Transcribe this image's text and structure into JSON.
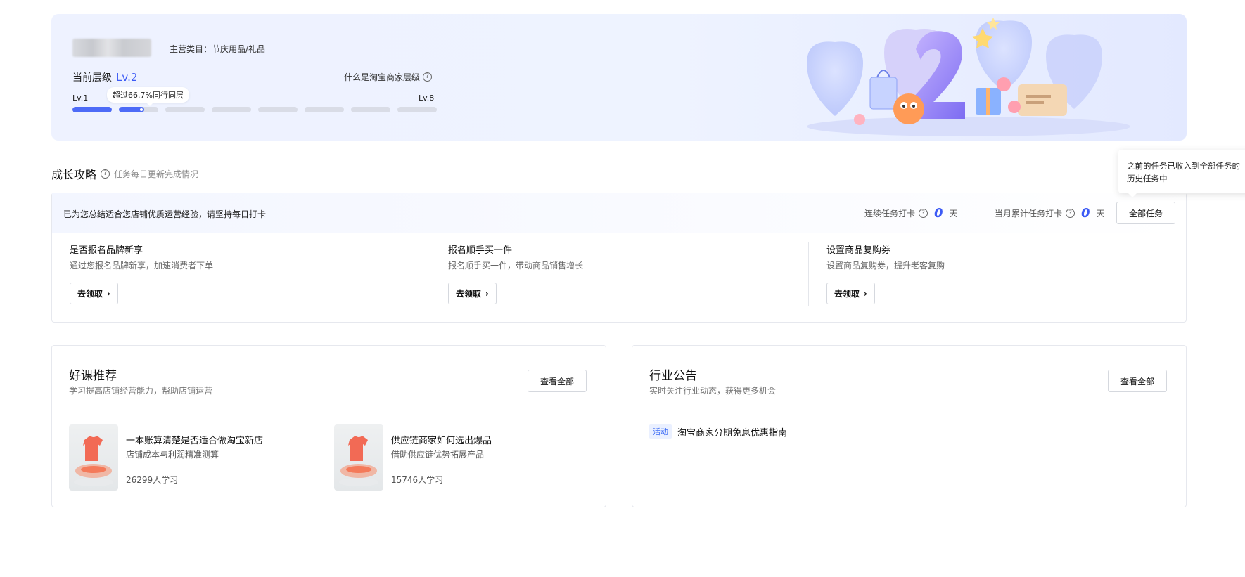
{
  "banner": {
    "category_label": "主营类目：",
    "category_value": "节庆用品/礼品",
    "current_level_label": "当前层级",
    "current_level_value": "Lv.2",
    "what_is_level": "什么是淘宝商家层级",
    "level_start": "Lv.1",
    "level_end": "Lv.8",
    "peer_tooltip": "超过66.7%同行同层",
    "progress": {
      "segments": 8,
      "current_index": 2,
      "current_fill_fraction": 0.65
    }
  },
  "growth": {
    "title": "成长攻略",
    "subtitle": "任务每日更新完成情况",
    "intro": "已为您总结适合您店铺优质运营经验，请坚持每日打卡",
    "streak_label": "连续任务打卡",
    "streak_value": "0",
    "streak_unit": "天",
    "month_label": "当月累计任务打卡",
    "month_value": "0",
    "month_unit": "天",
    "all_tasks_button": "全部任务",
    "tip_text": "之前的任务已收入到全部任务的历史任务中",
    "tasks": [
      {
        "name": "是否报名品牌新享",
        "desc": "通过您报名品牌新享，加速消费者下单",
        "button": "去领取"
      },
      {
        "name": "报名顺手买一件",
        "desc": "报名顺手买一件，带动商品销售增长",
        "button": "去领取"
      },
      {
        "name": "设置商品复购券",
        "desc": "设置商品复购券，提升老客复购",
        "button": "去领取"
      }
    ]
  },
  "courses": {
    "title": "好课推荐",
    "subtitle": "学习提高店铺经营能力，帮助店铺运营",
    "view_all": "查看全部",
    "items": [
      {
        "title": "一本账算清楚是否适合做淘宝新店",
        "subtitle": "店铺成本与利润精准测算",
        "learners": "26299人学习"
      },
      {
        "title": "供应链商家如何选出爆品",
        "subtitle": "借助供应链优势拓展产品",
        "learners": "15746人学习"
      }
    ]
  },
  "notices": {
    "title": "行业公告",
    "subtitle": "实时关注行业动态，获得更多机会",
    "view_all": "查看全部",
    "items": [
      {
        "tag": "活动",
        "text": "淘宝商家分期免息优惠指南"
      }
    ]
  },
  "colors": {
    "accent": "#3d5bf5",
    "progress": "#4d6bf7",
    "tag_bg": "#eaf0ff"
  },
  "icons": {
    "question": "question-circle-icon",
    "close": "close-icon",
    "chevron": "chevron-right-icon"
  }
}
